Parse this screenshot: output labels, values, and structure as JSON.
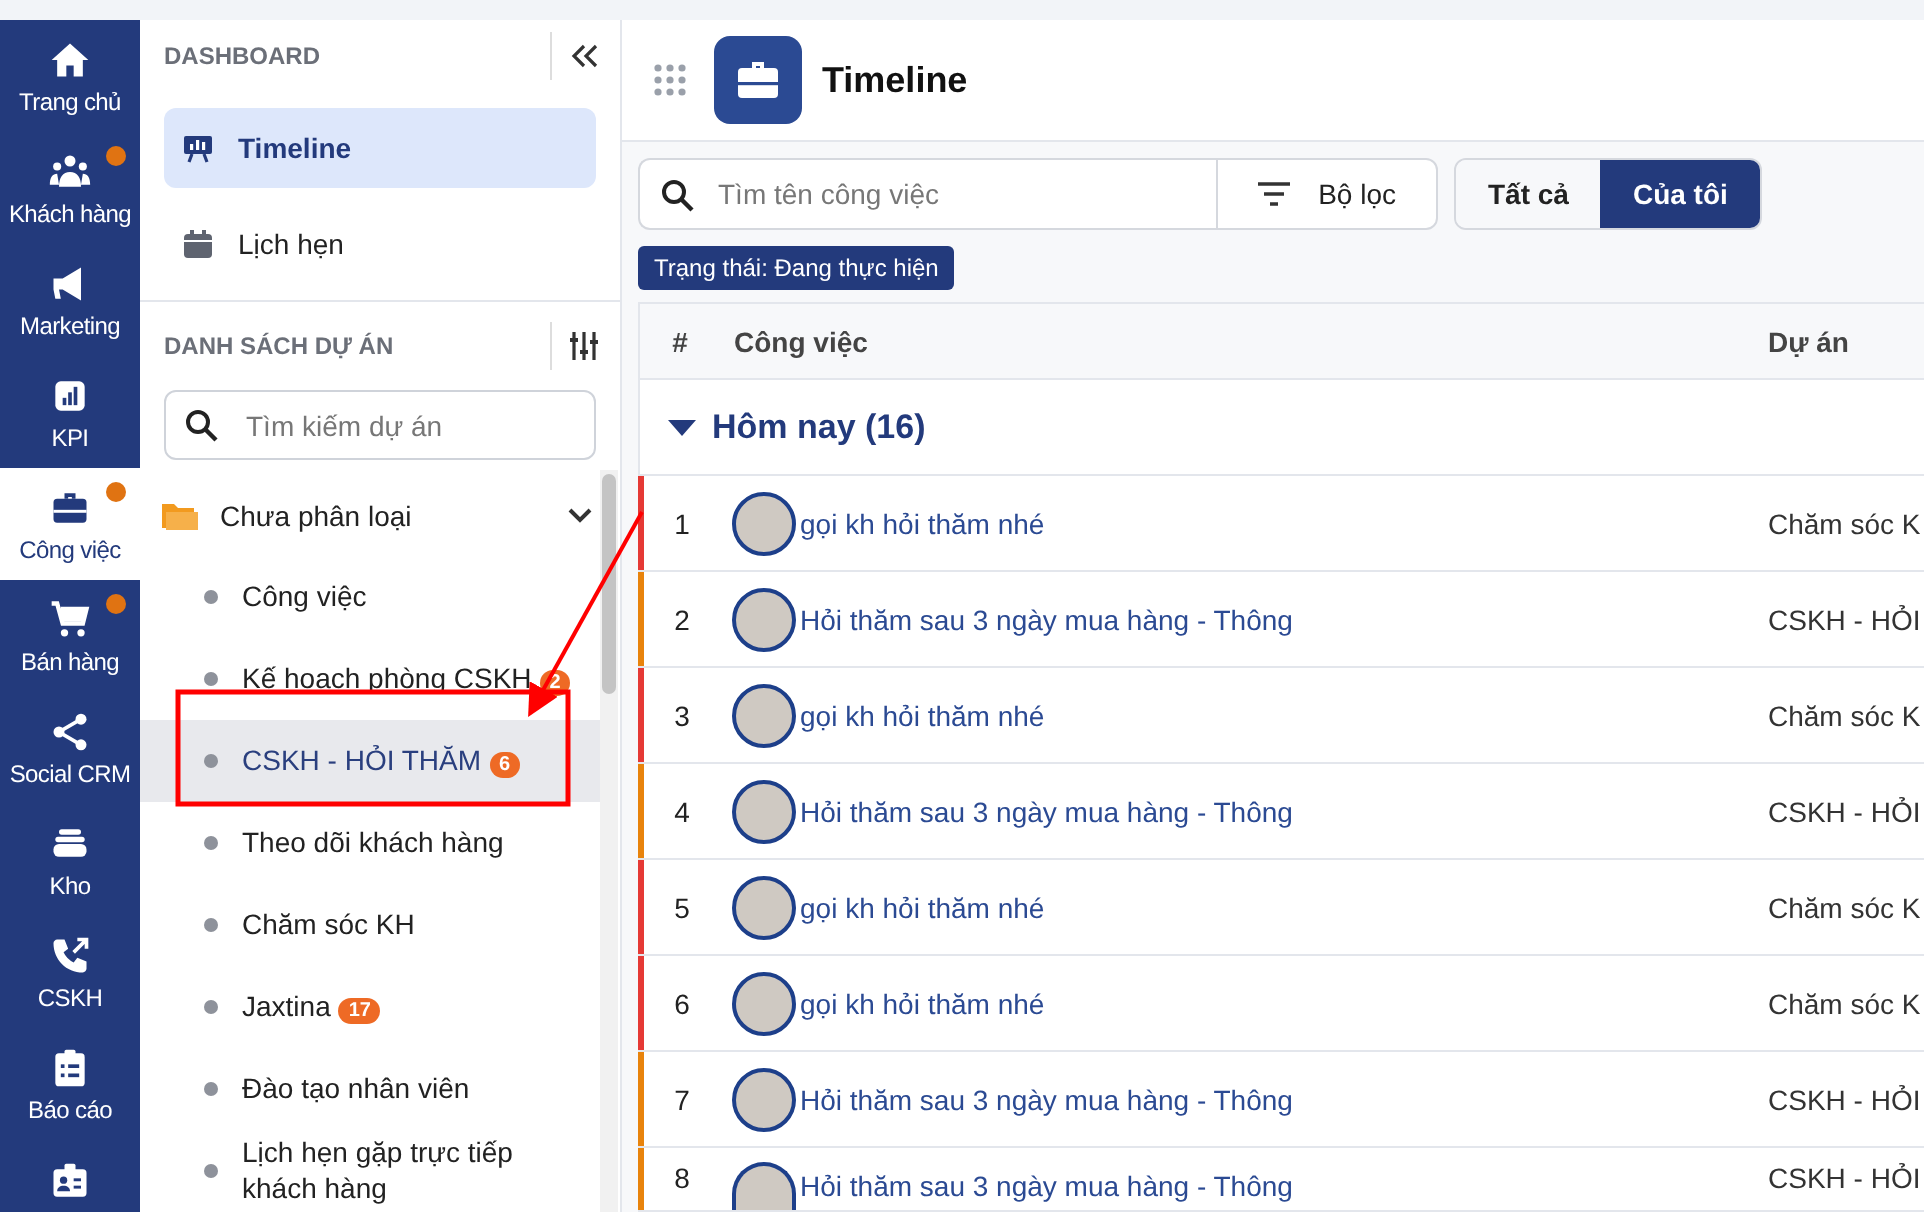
{
  "nav": [
    {
      "label": "Trang chủ",
      "selected": false,
      "dot": false
    },
    {
      "label": "Khách hàng",
      "selected": false,
      "dot": true
    },
    {
      "label": "Marketing",
      "selected": false,
      "dot": false
    },
    {
      "label": "KPI",
      "selected": false,
      "dot": false
    },
    {
      "label": "Công việc",
      "selected": true,
      "dot": true
    },
    {
      "label": "Bán hàng",
      "selected": false,
      "dot": true
    },
    {
      "label": "Social CRM",
      "selected": false,
      "dot": false
    },
    {
      "label": "Kho",
      "selected": false,
      "dot": false
    },
    {
      "label": "CSKH",
      "selected": false,
      "dot": false
    },
    {
      "label": "Báo cáo",
      "selected": false,
      "dot": false
    },
    {
      "selected": false,
      "dot": false
    }
  ],
  "sidebar": {
    "dashboard_title": "DASHBOARD",
    "dashboard_items": [
      {
        "label": "Timeline",
        "selected": true
      },
      {
        "label": "Lịch hẹn",
        "selected": false
      }
    ],
    "projects_title": "DANH SÁCH DỰ ÁN",
    "search": {
      "placeholder": "Tìm kiếm dự án"
    },
    "folder": {
      "label": "Chưa phân loại",
      "expanded": true,
      "children": [
        {
          "label": "Công việc",
          "selected": false
        },
        {
          "label": "Kế hoạch phòng CSKH",
          "badge": "2",
          "selected": false
        },
        {
          "label": "CSKH - HỎI THĂM",
          "badge": "6",
          "selected": true
        },
        {
          "label": "Theo dõi khách hàng",
          "selected": false
        },
        {
          "label": "Chăm sóc KH",
          "selected": false
        },
        {
          "label": "Jaxtina",
          "badge": "17",
          "selected": false
        },
        {
          "label": "Đào tạo nhân viên",
          "selected": false
        },
        {
          "label": "Lịch hẹn gặp trực tiếp khách hàng",
          "selected": false
        }
      ]
    }
  },
  "main": {
    "title": "Timeline",
    "search": {
      "placeholder": "Tìm tên công việc"
    },
    "filter_button": "Bộ lọc",
    "scope_tabs": [
      {
        "label": "Tất cả",
        "selected": false
      },
      {
        "label": "Của tôi",
        "selected": true
      }
    ],
    "filter_chip": "Trạng thái: Đang thực hiện",
    "table": {
      "columns": [
        "#",
        "Công việc",
        "Dự án"
      ],
      "group": {
        "label": "Hôm nay (16)",
        "expanded": true
      },
      "rows": [
        {
          "index": "1",
          "task": "gọi kh hỏi thăm nhé",
          "project": "Chăm sóc K",
          "color": "#e53935"
        },
        {
          "index": "2",
          "task": "Hỏi thăm sau 3 ngày mua hàng - Thông",
          "project": "CSKH - HỎI",
          "color": "#e8830c"
        },
        {
          "index": "3",
          "task": "gọi kh hỏi thăm nhé",
          "project": "Chăm sóc K",
          "color": "#e53935"
        },
        {
          "index": "4",
          "task": "Hỏi thăm sau 3 ngày mua hàng - Thông",
          "project": "CSKH - HỎI",
          "color": "#e8830c"
        },
        {
          "index": "5",
          "task": "gọi kh hỏi thăm nhé",
          "project": "Chăm sóc K",
          "color": "#e53935"
        },
        {
          "index": "6",
          "task": "gọi kh hỏi thăm nhé",
          "project": "Chăm sóc K",
          "color": "#e53935"
        },
        {
          "index": "7",
          "task": "Hỏi thăm sau 3 ngày mua hàng - Thông",
          "project": "CSKH - HỎI",
          "color": "#e8830c"
        },
        {
          "index": "8",
          "task": "Hỏi thăm sau 3 ngày mua hàng - Thông",
          "project": "CSKH - HỎI",
          "color": "#e8830c"
        }
      ]
    }
  }
}
